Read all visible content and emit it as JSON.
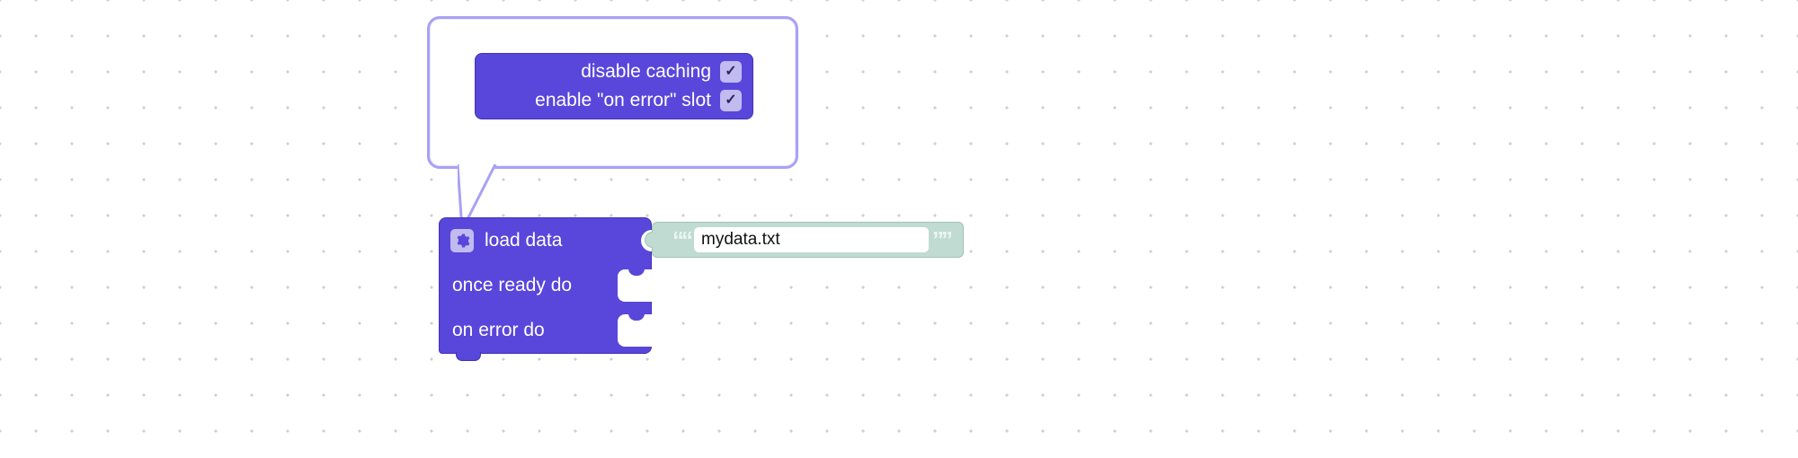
{
  "popup": {
    "options": [
      {
        "label": "disable caching",
        "checked": true
      },
      {
        "label": "enable \"on error\" slot",
        "checked": true
      }
    ]
  },
  "block": {
    "load_label": "load data",
    "ready_label": "once ready do",
    "error_label": "on error do",
    "file_value": "mydata.txt"
  },
  "glyphs": {
    "check": "✓"
  },
  "colors": {
    "block_fill": "#5946db",
    "block_border": "#4234b3",
    "accent_light": "#c2bbef",
    "popup_border": "#a9a1f4",
    "string_fill": "#bfdbd2",
    "string_border": "#9fc6ba"
  }
}
